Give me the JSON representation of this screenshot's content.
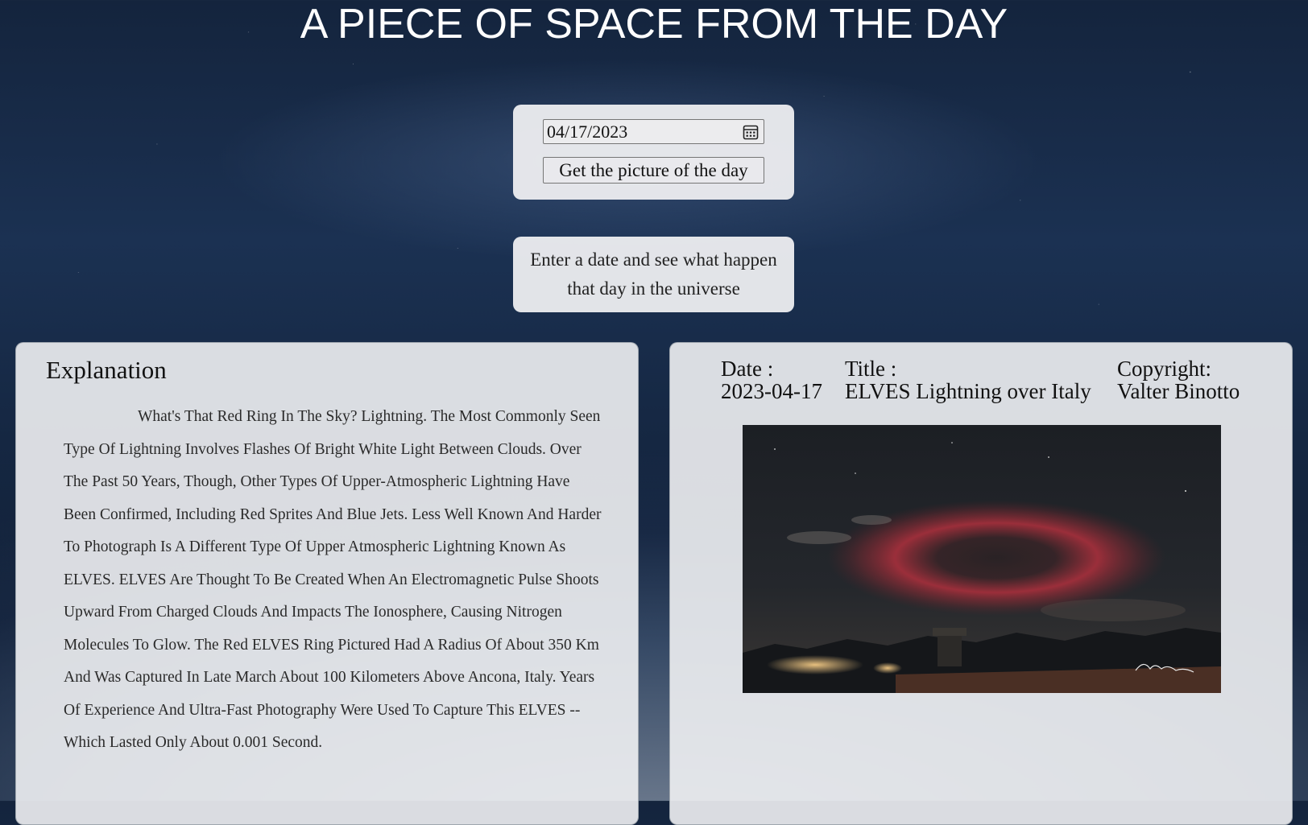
{
  "header": {
    "title": "A PIECE OF SPACE FROM THE DAY"
  },
  "form": {
    "date_value": "04/17/2023",
    "submit_label": "Get the picture of the day"
  },
  "hint": {
    "text": "Enter a date and see what happen that day in the universe"
  },
  "explanation": {
    "heading": "Explanation",
    "body": "What's That Red Ring In The Sky? Lightning. The Most Commonly Seen Type Of Lightning Involves Flashes Of Bright White Light Between Clouds. Over The Past 50 Years, Though, Other Types Of Upper-Atmospheric Lightning Have Been Confirmed, Including Red Sprites And Blue Jets. Less Well Known And Harder To Photograph Is A Different Type Of Upper Atmospheric Lightning Known As ELVES. ELVES Are Thought To Be Created When An Electromagnetic Pulse Shoots Upward From Charged Clouds And Impacts The Ionosphere, Causing Nitrogen Molecules To Glow. The Red ELVES Ring Pictured Had A Radius Of About 350 Km And Was Captured In Late March About 100 Kilometers Above Ancona, Italy. Years Of Experience And Ultra-Fast Photography Were Used To Capture This ELVES -- Which Lasted Only About 0.001 Second."
  },
  "details": {
    "date_label": "Date :",
    "date_value": "2023-04-17",
    "title_label": "Title :",
    "title_value": "ELVES Lightning over Italy",
    "copyright_label": "Copyright:",
    "copyright_value": "Valter Binotto"
  },
  "icons": {
    "calendar": "calendar-icon"
  }
}
